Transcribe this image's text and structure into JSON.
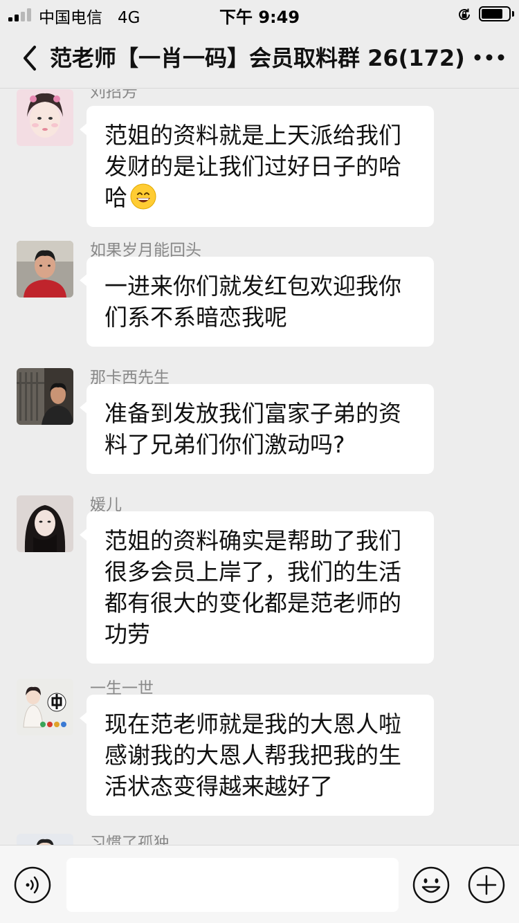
{
  "status_bar": {
    "carrier": "中国电信",
    "network": "4G",
    "time": "下午 9:49",
    "battery_level": 0.8
  },
  "nav": {
    "title": "范老师【一肖一码】会员取料群 26(172)",
    "back_icon": "chevron-left-icon",
    "more_icon": "more-dots-icon"
  },
  "messages": [
    {
      "sender": "刘招芳",
      "text": "范姐的资料就是上天派给我们发财的是让我们过好日子的哈哈",
      "emoji": "grinning-face"
    },
    {
      "sender": "如果岁月能回头",
      "text": "一进来你们就发红包欢迎我你们系不系暗恋我呢"
    },
    {
      "sender": "那卡西先生",
      "text": "准备到发放我们富家子弟的资料了兄弟们你们激动吗?"
    },
    {
      "sender": "媛儿",
      "text": "范姐的资料确实是帮助了我们很多会员上岸了，我们的生活都有很大的变化都是范老师的功劳"
    },
    {
      "sender": "一生一世",
      "text": "现在范老师就是我的大恩人啦感谢我的大恩人帮我把我的生活状态变得越来越好了"
    },
    {
      "sender": "习惯了孤独",
      "text": ""
    }
  ],
  "input_bar": {
    "placeholder": "",
    "voice_icon": "voice-icon",
    "emoji_icon": "smiley-icon",
    "plus_icon": "plus-icon"
  },
  "colors": {
    "background": "#ededed",
    "bubble": "#ffffff",
    "sender_name": "#888888",
    "title": "#111111"
  }
}
